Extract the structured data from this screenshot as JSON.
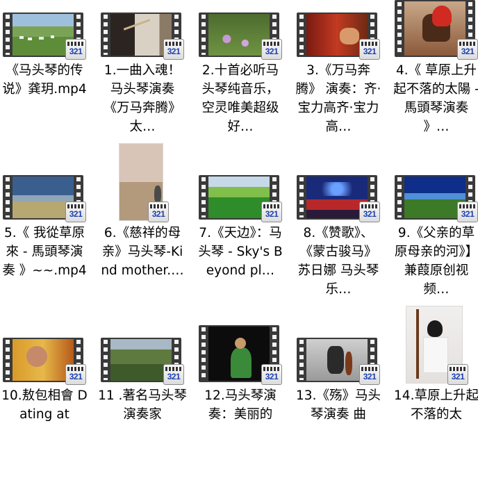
{
  "files": [
    {
      "label": "《马头琴的传说》龚玥.mp4",
      "badge": "321",
      "thumb": "landscape",
      "scene": "grassland-cattle"
    },
    {
      "label": "1.一曲入魂！马头琴演奏《万马奔腾》太…",
      "badge": "321",
      "thumb": "landscape",
      "scene": "musician-closeup"
    },
    {
      "label": "2.十首必听马头琴纯音乐，空灵唯美超级好…",
      "badge": "321",
      "thumb": "landscape",
      "scene": "flower-meadow"
    },
    {
      "label": "3.《万马奔腾》 演奏：齐·宝力高齐·宝力高…",
      "badge": "321",
      "thumb": "landscape",
      "scene": "red-costume-performer"
    },
    {
      "label": "4.《 草原上升起不落的太陽 - 馬頭琴演奏 》…",
      "badge": "321",
      "thumb": "landscape",
      "scene": "woman-on-horse"
    },
    {
      "label": "5.《 我從草原來 - 馬頭琴演奏 》~~.mp4",
      "badge": "321",
      "thumb": "landscape",
      "scene": "cloudy-steppe"
    },
    {
      "label": "6.《慈祥的母亲》马头琴-Kind mother.…",
      "badge": "321",
      "thumb": "portrait",
      "scene": "steppe-portrait"
    },
    {
      "label": "7.《天边》：马头琴 - Sky's Beyond pl…",
      "badge": "321",
      "thumb": "landscape",
      "scene": "green-plain"
    },
    {
      "label": "8.《赞歌》、《蒙古骏马》苏日娜 马头琴乐…",
      "badge": "321",
      "thumb": "landscape",
      "scene": "concert-stage"
    },
    {
      "label": "9.《父亲的草原母亲的河》】兼葭原创视频…",
      "badge": "321",
      "thumb": "landscape",
      "scene": "blue-sky-field"
    },
    {
      "label": "10.敖包相會 Dating at",
      "badge": "321",
      "thumb": "landscape",
      "scene": "elder-performer"
    },
    {
      "label": "11 .著名马头琴演奏家",
      "badge": "321",
      "thumb": "landscape",
      "scene": "canyon"
    },
    {
      "label": "12.马头琴演奏：美丽的",
      "badge": "321",
      "thumb": "landscape",
      "scene": "stage-green-robe"
    },
    {
      "label": "13.《殇》马头琴演奏 曲",
      "badge": "321",
      "thumb": "landscape",
      "scene": "seated-player"
    },
    {
      "label": "14.草原上升起不落的太",
      "badge": "321",
      "thumb": "portrait",
      "scene": "woman-with-fiddle"
    }
  ]
}
